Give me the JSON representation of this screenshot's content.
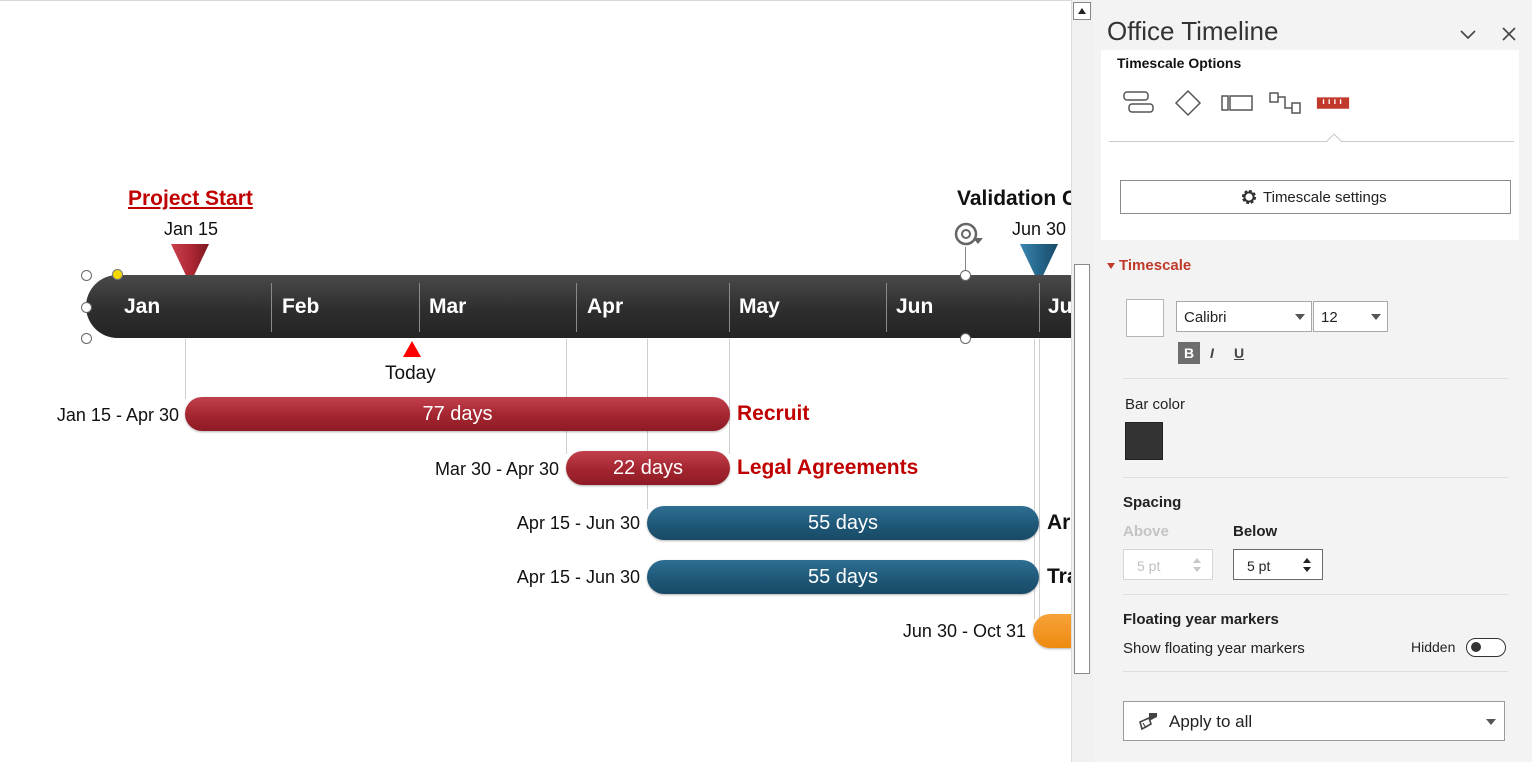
{
  "slide": {
    "milestones": [
      {
        "title": "Project Start",
        "date": "Jan 15",
        "color": "#c00000"
      },
      {
        "title": "Validation C",
        "date": "Jun 30",
        "color": "#111111"
      }
    ],
    "timescale": {
      "months": [
        "Jan",
        "Feb",
        "Mar",
        "Apr",
        "May",
        "Jun",
        "Ju"
      ],
      "bar_color": "#333333"
    },
    "today_label": "Today",
    "tasks": [
      {
        "dates": "Jan 15 - Apr 30",
        "duration": "77 days",
        "title": "Recruit",
        "color": "#a3252f",
        "title_color": "#c00000"
      },
      {
        "dates": "Mar 30 - Apr 30",
        "duration": "22 days",
        "title": "Legal Agreements",
        "color": "#a3252f",
        "title_color": "#c00000"
      },
      {
        "dates": "Apr 15 - Jun 30",
        "duration": "55 days",
        "title": "Ar",
        "color": "#1f5878",
        "title_color": "#111111"
      },
      {
        "dates": "Apr 15 - Jun 30",
        "duration": "55 days",
        "title": "Tra",
        "color": "#1f5878",
        "title_color": "#111111"
      },
      {
        "dates": "Jun 30 - Oct 31",
        "duration": "",
        "title": "",
        "color": "#ee8a0f",
        "title_color": "#111111"
      }
    ]
  },
  "scrollbar": {
    "up_arrow_icon": "triangle-up-icon"
  },
  "panel": {
    "title": "Office Timeline",
    "section_title": "Timescale Options",
    "tool_icons": [
      "task-style-icon",
      "milestone-diamond-icon",
      "swimlane-icon",
      "dependency-icon",
      "timescale-ruler-icon"
    ],
    "settings_button": "Timescale settings",
    "timescale_header": "Timescale",
    "font_name": "Calibri",
    "font_size": "12",
    "bold": "B",
    "italic": "I",
    "underline": "U",
    "bar_color_label": "Bar color",
    "bar_color_value": "#333333",
    "spacing_label": "Spacing",
    "above_label": "Above",
    "above_value": "5 pt",
    "below_label": "Below",
    "below_value": "5 pt",
    "floating_label": "Floating year markers",
    "show_floating_label": "Show floating year markers",
    "toggle_state": "Hidden",
    "apply_label": "Apply to all",
    "accent_color": "#c0392b"
  }
}
